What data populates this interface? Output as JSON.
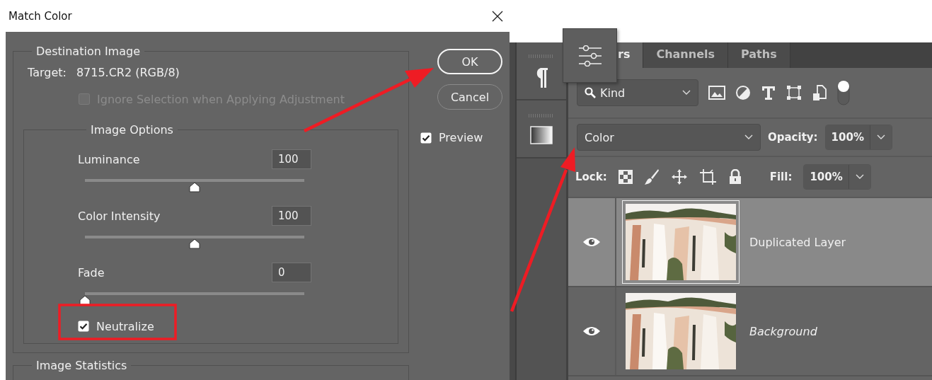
{
  "dialog": {
    "title": "Match Color",
    "destination": {
      "legend": "Destination Image",
      "target_label": "Target:",
      "target_value": "8715.CR2 (RGB/8)",
      "ignore_selection": {
        "label": "Ignore Selection when Applying Adjustment",
        "checked": false,
        "disabled": true
      }
    },
    "image_options": {
      "legend": "Image Options",
      "sliders": [
        {
          "label": "Luminance",
          "value": "100",
          "level": 0.5
        },
        {
          "label": "Color Intensity",
          "value": "100",
          "level": 0.5
        },
        {
          "label": "Fade",
          "value": "0",
          "level": 0
        }
      ],
      "neutralize": {
        "label": "Neutralize",
        "checked": true
      }
    },
    "image_statistics": {
      "legend": "Image Statistics"
    },
    "buttons": [
      {
        "label": "OK",
        "default": true
      },
      {
        "label": "Cancel",
        "default": false
      }
    ],
    "preview": {
      "label": "Preview",
      "checked": true
    }
  },
  "layers_panel": {
    "tabs": [
      {
        "label": "rs",
        "selected": true
      },
      {
        "label": "Channels",
        "selected": false
      },
      {
        "label": "Paths",
        "selected": false
      }
    ],
    "filter": "Kind",
    "blend_mode": "Color",
    "opacity_label": "Opacity:",
    "opacity": "100%",
    "lock_label": "Lock:",
    "fill_label": "Fill:",
    "fill": "100%",
    "layers": [
      {
        "name": "Duplicated Layer",
        "visible": true,
        "selected": true,
        "kind": "layer"
      },
      {
        "name": "Background",
        "visible": true,
        "selected": false,
        "kind": "background"
      }
    ]
  }
}
